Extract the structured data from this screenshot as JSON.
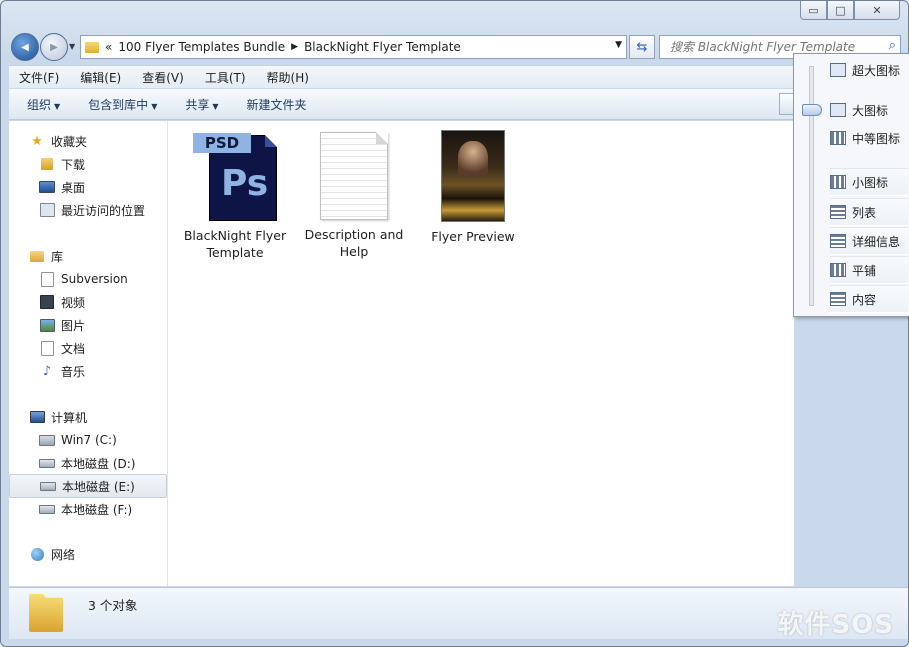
{
  "window": {
    "caption": {
      "minimize": "▭",
      "maximize": "□",
      "close": "✕"
    }
  },
  "navigation": {
    "back_icon": "◀",
    "forward_icon": "▶",
    "history_dropdown": "▼",
    "breadcrumb_overflow": "«",
    "breadcrumbs": [
      "100 Flyer Templates Bundle",
      "BlackNight Flyer Template"
    ],
    "crumb_separator": "▶",
    "address_dropdown": "▼",
    "refresh_icon": "⇆",
    "search_placeholder": "搜索 BlackNight Flyer Template",
    "search_icon": "⌕"
  },
  "menubar": [
    "文件(F)",
    "编辑(E)",
    "查看(V)",
    "工具(T)",
    "帮助(H)"
  ],
  "toolbar": {
    "organize": "组织",
    "include_in_library": "包含到库中",
    "share": "共享",
    "new_folder": "新建文件夹",
    "dropdown_arrow": "▼"
  },
  "sidebar": {
    "favorites": "收藏夹",
    "downloads": "下载",
    "desktop": "桌面",
    "recent": "最近访问的位置",
    "libraries": "库",
    "subversion": "Subversion",
    "videos": "视频",
    "pictures": "图片",
    "documents": "文档",
    "music": "音乐",
    "computer": "计算机",
    "drive_c": "Win7 (C:)",
    "drive_d": "本地磁盘 (D:)",
    "drive_e": "本地磁盘 (E:)",
    "drive_f": "本地磁盘 (F:)",
    "network": "网络"
  },
  "files": [
    {
      "name": "BlackNight Flyer Template",
      "type": "psd",
      "badge": "PSD",
      "glyph": "Ps"
    },
    {
      "name": "Description and Help",
      "type": "text"
    },
    {
      "name": "Flyer Preview",
      "type": "image"
    }
  ],
  "status": {
    "count": "3 个对象",
    "watermark": "软件SOS"
  },
  "view_menu": {
    "items": [
      "超大图标",
      "大图标",
      "中等图标",
      "小图标",
      "列表",
      "详细信息",
      "平铺",
      "内容"
    ],
    "selected": "大图标"
  }
}
